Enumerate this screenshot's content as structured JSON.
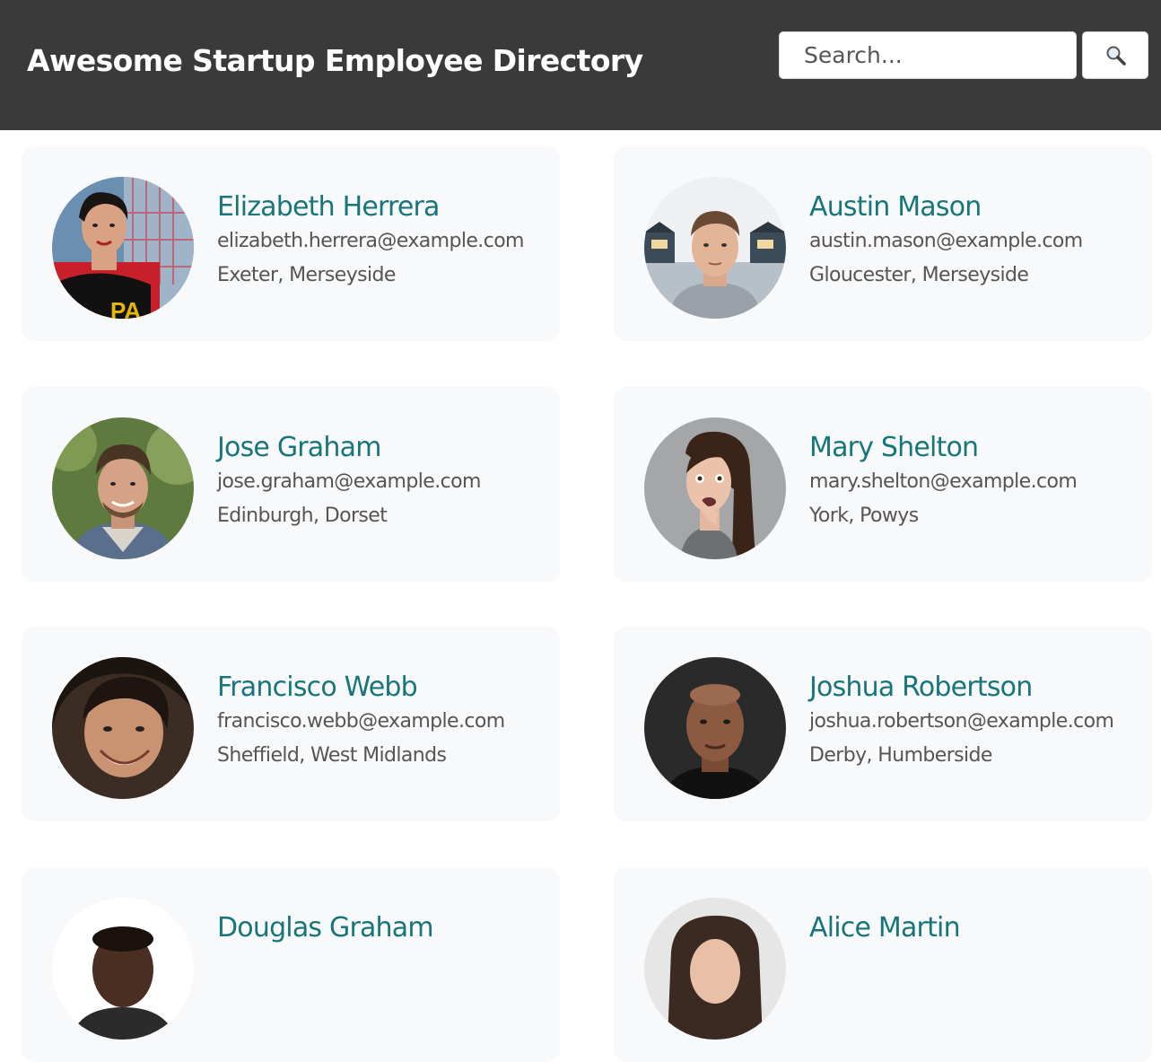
{
  "header": {
    "title": "Awesome Startup Employee Directory",
    "search_placeholder": "Search...",
    "search_button_icon": "magnifier-icon"
  },
  "colors": {
    "header_bg": "#3a3a3a",
    "name_accent": "#18757a",
    "card_bg": "#f8f9fb",
    "text_muted": "#555555"
  },
  "employees": [
    {
      "name": "Elizabeth Herrera",
      "email": "elizabeth.herrera@example.com",
      "location": "Exeter, Merseyside"
    },
    {
      "name": "Austin Mason",
      "email": "austin.mason@example.com",
      "location": "Gloucester, Merseyside"
    },
    {
      "name": "Jose Graham",
      "email": "jose.graham@example.com",
      "location": "Edinburgh, Dorset"
    },
    {
      "name": "Mary Shelton",
      "email": "mary.shelton@example.com",
      "location": "York, Powys"
    },
    {
      "name": "Francisco Webb",
      "email": "francisco.webb@example.com",
      "location": "Sheffield, West Midlands"
    },
    {
      "name": "Joshua Robertson",
      "email": "joshua.robertson@example.com",
      "location": "Derby, Humberside"
    },
    {
      "name": "Douglas Graham",
      "email": "",
      "location": ""
    },
    {
      "name": "Alice Martin",
      "email": "",
      "location": ""
    }
  ]
}
